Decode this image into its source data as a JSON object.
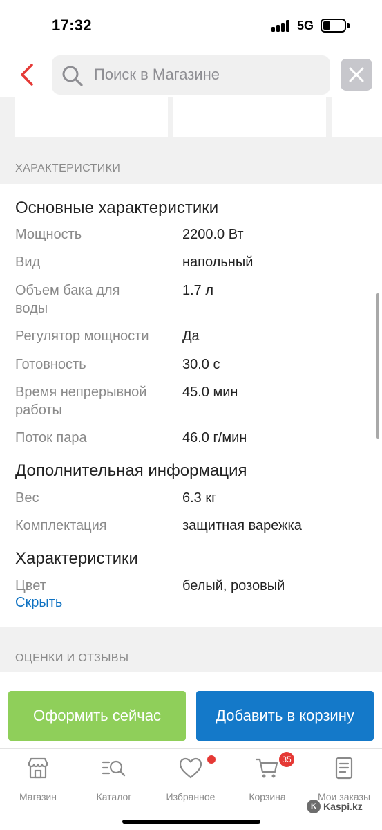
{
  "status_bar": {
    "time": "17:32",
    "network": "5G"
  },
  "search": {
    "placeholder": "Поиск в Магазине"
  },
  "sections": {
    "characteristics_header": "ХАРАКТЕРИСТИКИ",
    "reviews_header": "ОЦЕНКИ И ОТЗЫВЫ"
  },
  "spec_groups": [
    {
      "title": "Основные характеристики",
      "rows": [
        {
          "name": "Мощность",
          "value": "2200.0 Вт"
        },
        {
          "name": "Вид",
          "value": "напольный"
        },
        {
          "name": "Объем бака для воды",
          "value": "1.7 л"
        },
        {
          "name": "Регулятор мощности",
          "value": "Да"
        },
        {
          "name": "Готовность",
          "value": "30.0 с"
        },
        {
          "name": "Время непрерывной работы",
          "value": "45.0 мин"
        },
        {
          "name": "Поток пара",
          "value": "46.0 г/мин"
        }
      ]
    },
    {
      "title": "Дополнительная информация",
      "rows": [
        {
          "name": "Вес",
          "value": "6.3 кг"
        },
        {
          "name": "Комплектация",
          "value": "защитная варежка"
        }
      ]
    },
    {
      "title": "Характеристики",
      "rows": [
        {
          "name": "Цвет",
          "value": "белый, розовый"
        }
      ]
    }
  ],
  "hide_link": "Скрыть",
  "actions": {
    "checkout": "Оформить сейчас",
    "add_to_cart": "Добавить в корзину"
  },
  "tabs": [
    {
      "label": "Магазин",
      "icon": "shop-icon"
    },
    {
      "label": "Каталог",
      "icon": "catalog-search-icon"
    },
    {
      "label": "Избранное",
      "icon": "heart-icon"
    },
    {
      "label": "Корзина",
      "icon": "cart-icon"
    },
    {
      "label": "Мои заказы",
      "icon": "orders-icon"
    }
  ],
  "cart_badge": "35",
  "watermark": "Kaspi.kz",
  "colors": {
    "accent_red": "#e53935",
    "checkout_green": "#8fcf5a",
    "cart_blue": "#1479c9",
    "link_blue": "#0f72c2"
  }
}
